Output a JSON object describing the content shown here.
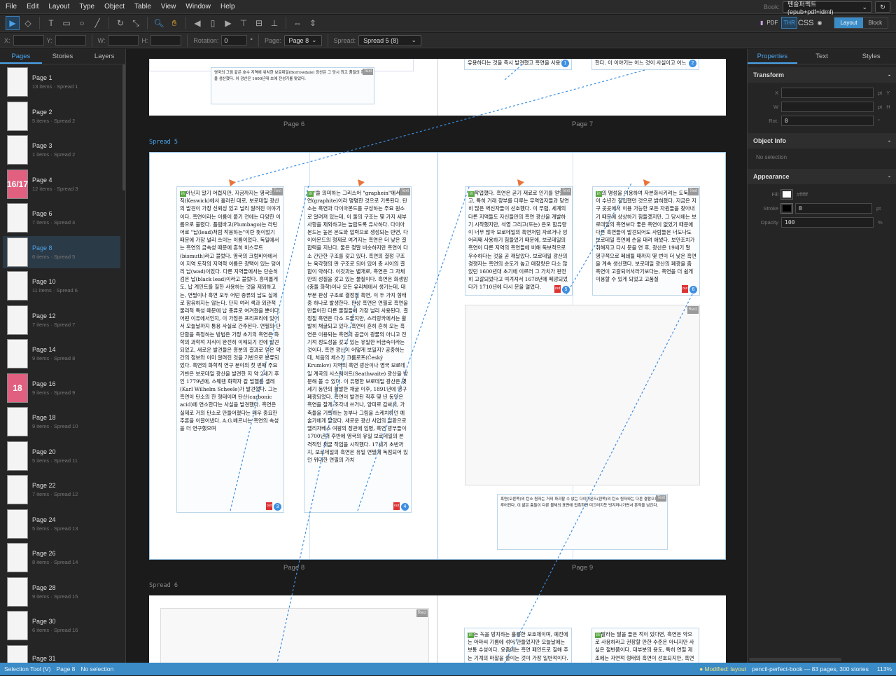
{
  "menu": [
    "File",
    "Edit",
    "Layout",
    "Type",
    "Object",
    "Table",
    "View",
    "Window",
    "Help"
  ],
  "book": {
    "label": "Book:",
    "value": "펜슬퍼펙트 (epub+pdf+idml)",
    "refresh": "↻"
  },
  "toolbar": {
    "export": [
      "PDF",
      "THR",
      "CSS"
    ],
    "modes": [
      "Layout",
      "Block"
    ]
  },
  "propbar": {
    "x": "X:",
    "y": "Y:",
    "w": "W:",
    "h": "H:",
    "rotation_label": "Rotation:",
    "rotation": "0",
    "deg": "°",
    "page_label": "Page:",
    "page": "Page 8",
    "spread_label": "Spread:",
    "spread": "Spread 5 (8)"
  },
  "left": {
    "tabs": [
      "Pages",
      "Stories",
      "Layers"
    ],
    "pages": [
      {
        "name": "Page 1",
        "sub": "13 items · Spread 1"
      },
      {
        "name": "Page 2",
        "sub": "5 items · Spread 2"
      },
      {
        "name": "Page 3",
        "sub": "1 items · Spread 2"
      },
      {
        "name": "Page 4",
        "sub": "12 items · Spread 3",
        "thumb": "16/17"
      },
      {
        "name": "Page 6",
        "sub": "7 items · Spread 4"
      },
      {
        "name": "Page 8",
        "sub": "6 items · Spread 5"
      },
      {
        "name": "Page 10",
        "sub": "11 items · Spread 6"
      },
      {
        "name": "Page 12",
        "sub": "7 items · Spread 7"
      },
      {
        "name": "Page 14",
        "sub": "9 items · Spread 8"
      },
      {
        "name": "Page 16",
        "sub": "9 items · Spread 9",
        "thumb": "18"
      },
      {
        "name": "Page 18",
        "sub": "9 items · Spread 10"
      },
      {
        "name": "Page 20",
        "sub": "5 items · Spread 11"
      },
      {
        "name": "Page 22",
        "sub": "7 items · Spread 12"
      },
      {
        "name": "Page 24",
        "sub": "5 items · Spread 13"
      },
      {
        "name": "Page 26",
        "sub": "8 items · Spread 14"
      },
      {
        "name": "Page 28",
        "sub": "9 items · Spread 15"
      },
      {
        "name": "Page 30",
        "sub": "6 items · Spread 16"
      },
      {
        "name": "Page 31",
        "sub": ""
      }
    ]
  },
  "canvas": {
    "page6": "Page 6",
    "page7": "Page 7",
    "spread5": "Spread 5",
    "page8": "Page 8",
    "page9": "Page 9",
    "spread6": "Spread 6",
    "top_caption": "영국의 그림 같은 호수 지역에 위치한 보로데일(Borrowdale) 광산은 그 당시 최고 품질의 흑연을 생산했다. 이 광산은 1600년대 초에 전성기를 맞았다.",
    "top_f1": "유용하다는 것을 즉시 발견했고 흑연을 사용해",
    "top_f2": "한다. 이 이야기는 어느 것이 사실이고 어느",
    "f1": "아닌지 알기 어렵지만, 지금까지는 영국의 케직(Keswick)에서 흘러린 대로, 보로데일 광산의 발견이 가장 신뢰성 있고 널리 알려진 이야기이다. 흑연이라는 이름이 붙기 전에는 다양한 이름으로 불렸다. 플럼바고(Plumbago)는 라틴어로 \"납(lead)처럼 작용하는\"이란 뜻이었기 때문에 가장 널리 쓰이는 이름이었다. 독일에서는 흑연의 금속성 때문에 흔히 비스무트(bismuth)라고 불렀다. 영국의 크럼비아에서 이 지역 토착의 지역적 이름은 광택이 있는 덩어리 납(wad)이었다. 다른 지역들에서는 단순히 검은 납(black lead)이라고 불렀다. 흥미롭게도, 납 계인트를 칠한 사용하는 것을 제외하고는, 연필이나 흑연 모두 어떤 종류의 납도 실제로 함유하지는 않는다. 단지 여러 색과 외관적 물리적 특성 때문에 납 종류로 여겨졌을 뿐이다. 어떤 이유에서인지, 이 가정은 프리프리에 있어서 오늘날까지 통용 사실로 간주된다. 연필의 단단함을 측정하는 방법은 가정 초기의 흑연은 화학의 과학적 지식이 완전히 이해되기 전에 발견되었고, 새로운 발견들은 흥분의 결과로 얻은 약간의 정보와 이미 알려진 것을 기반으로 분류되었다. 흑연의 화학적 연구 분야의 첫 번째 주요 기반은 보로데일 광산을 발견한 지 약 2세기 후인 1779년에, 스웨덴 화학자 칼 빌헬름 셸레(Karl Wilhelm Scheele)가 발견했다. 그는 흑연이 탄소의 한 형태이며 탄산(carbonic acid)에 연소한다는 사실을 발견했다. 흑연은 실제로 거의 탄소로 만들어졌다는 매우 중요한 추론을 이끌어냈다. A.G.베르너는 흑연의 속성을 더 연구했으며",
    "f2": "\"쓸 의미하는 그리스어 \"graphein\"에서 흑연(graphite)이라 명명한 것으로 기록된다. 탄소는 흑연과 다이아몬드를 구성하는 주요 원소로 알려져 있는데, 이 둘의 구조는 몇 가지 세부 사항을 제외하고는 놀랍도록 유사하다. 다이아몬드는 높은 온도와 압력으로 생성되는 반면, 다이아몬드의 형제로 여겨지는 흑연은 더 낮은 결합력을 지닌다. 둘은 정말 비슷하지만 흑연이 다소 간단한 구조를 갖고 있다. 흑연의 결정 구조는 육각형의 판 구조로 되어 있어 층 사이의 결합이 약하다. 이것과는 별개로, 흑연은 그 자체만의 성질을 갖고 있는 물질이다. 흑연은 화생암(충돌 화학)이나 모든 유리체에서 생기는데, 대부분 판상 구조로 결정질 흑연, 이 두 가지 형태 중 하나로 발생한다. 판상 흑연은 연필로 흑연을 만들어진 다른 물질들에 가장 널리 사용된다. 결정질 흑연은 다소 드물지만, 스리랑카에서는 활발히 채굴되고 있다. 흑연이 흔히 흔히 오는 흑연은 이용되는 흑연의 공급이 광물의 아니고 전기적 정도성을 갖고 있는 유일한 비금속이라는 것이다. 흑연 광산이 어떻게 보일지? 공중하는데, 처음의 체스키 크룸로프(Český Krumlov) 지역의 흑연 광산이나 영국 보로데일 계곡의 시스웨이트(Seathwaite) 광산을 방문해 볼 수 있다. 이 유명한 보로데일 광산은 몇 세기 동안의 활발한 채굴 이후, 1891년에 영구 폐광되었다. 흑연이 발견된 직후 몇 년 동안은 흑연을 잘게 조각내 쓰거나, 양피로 감싸서, 가축들을 기록하는 농부나 그림을 스케치하던 예술가에게 팔았다. 새로운 광산 사업의 일환으로 엘리자베스 여왕의 장관에 임명, 흑연 광부들이 1700년대 후반에 영국의 유일 보로데일의 본격적인 채굴 작업을 시작했다. 17세기 초반까지, 보로데일의 흑연은 유일 연필에 독점되어 있던 위대한 연필의 가치",
    "f3": "작업했다. 흑연은 곧기 재료로 인기를 얻었고, 특히 거래 장부를 다루는 무역업자들과 당연히 많은 벽신자들이 선호했다. 이 무렵, 세계의 다른 지역들도 자신들만의 흑연 광산을 개발하기 시작했지만, 석영 그리고(또는) 은모 함유량이 너무 많아 보로데일의 흑연처럼 자르거나 잉어리째 사용하기 힘들었기 때문에, 보로데일의 흑연이 다른 지역의 흑연들에 비해 독보적으로 우수하다는 것을 곧 깨달았다. 보로데일 광산의 경쟁자는 흑연의 순도가 높고 매장량은 다소 많았던 1600년대 초기에 이르러 그 가치가 완전히 고갈되었다고 여겨져서 1678년에 폐광되었다가 1710년에 다시 문을 열었다.",
    "f4": "의 명성을 이용하여 자본화시키려는 도둑들이 수년간 침입했던 것으로 밝혀졌다. 지금은 지구 곳곳에서 이용 가능한 모든 자원들을 찾아내기 때문에 상상하기 힘들겠지만, 그 당시에는 보로데일의 흑연보다 좋은 흑연이 없었기 때문에 다른 흑연들이 발견되어도 사람들은 너도나도 보로데일 흑연에 손을 대려 애썼다. 보안조치가 취해지고 다시 문을 연 후, 광산은 19세기 말 영구적으로 폐쇄될 때까지 몇 번이 더 낮은 흑연을 계속 생산했다. 보로데일 광산의 폐광을 좀 흑연이 고갈되어서라기보다는, 흑연을 더 쉽게 이용할 수 있게 되었고 고품질",
    "f5": "흑연(오른쪽)의 탄소 원자는 거의 파괴할 수 없는 다이아몬드(왼쪽)의 탄소 원자와는 다른 결합으로 이루어진다. 이 얇은 층들이 다른 물체의 표면에 접촉하면 미끄러지듯 벗겨져나가면서 흔적을 남긴다.",
    "f6": "는 녹을 방지하는 훌륭한 보호제이며, 예전에는 아마씨 기름에 섞어 만들었지만 오늘날에는 보통 수성이다. 요즘에는 흑연 페인트로 칠해 주는 기계의 마찰을 줄이는 것이 가장 일반적이다.",
    "f7": "말라는 말을 들은 적이 있다면, 흑연은 약으로 사용하라고 권장할 만한 수준은 아니지만 사실은 절반쯤이다. 대부분의 용도, 특히 연필 제조에는 자연적 형태의 흑연이 선호되지만, 흑연은 합성으로도 쉽게 만들어진다.",
    "tag_text": "Text",
    "tag_rect": "Rect",
    "in": "in",
    "out": "out",
    "badges": [
      "1",
      "2",
      "3",
      "4",
      "5",
      "6"
    ]
  },
  "right": {
    "tabs": [
      "Properties",
      "Text",
      "Styles"
    ],
    "transform": {
      "title": "Transform",
      "x": "X",
      "y": "Y",
      "w": "W",
      "h": "H",
      "rot": "Rot.",
      "rot_value": "0",
      "pt": "pt",
      "deg": "°"
    },
    "object_info": {
      "title": "Object Info",
      "text": "No selection"
    },
    "appearance": {
      "title": "Appearance",
      "fill": "Fill",
      "fill_value": "#ffffff",
      "stroke": "Stroke",
      "stroke_value": "0",
      "opacity": "Opacity",
      "opacity_value": "100",
      "pt": "pt",
      "pct": "%"
    },
    "collapse": "-"
  },
  "status": {
    "tool": "Selection Tool (V)",
    "page": "Page 8",
    "selection": "No selection",
    "modified": "● Modified: layout",
    "doc": "pencil-perfect-book — 83 pages, 300 stories",
    "zoom": "113%"
  }
}
